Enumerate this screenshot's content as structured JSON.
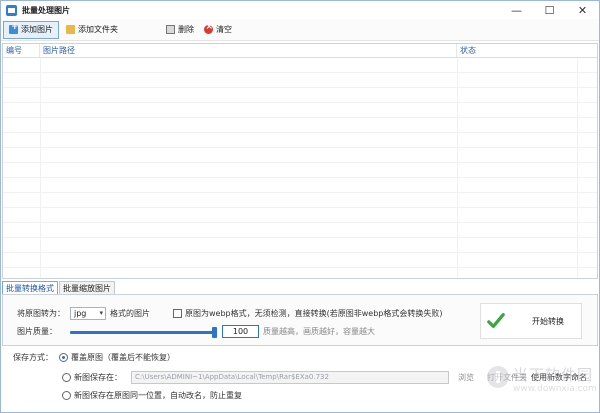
{
  "window": {
    "title": "批量处理图片",
    "controls": [
      "—",
      "☐",
      "✕"
    ]
  },
  "toolbar": {
    "add_image": "添加图片",
    "add_folder": "添加文件夹",
    "delete": "删除",
    "clear": "清空"
  },
  "list": {
    "columns": [
      "编号",
      "图片路径",
      "状态"
    ]
  },
  "tabs": [
    "批量转换格式",
    "批量缩放图片"
  ],
  "convert": {
    "convert_to_label": "将原图转为：",
    "format_value": "jpg",
    "format_suffix": "格式的图片",
    "webp_checkbox_label": "原图为webp格式，无须检测，直接转换(若原图非webp格式会转换失败)",
    "quality_label": "图片质量：",
    "quality_value": "100",
    "quality_fraction": 1.0,
    "quality_hint": "质量越高，画质越好，容量越大",
    "start_button": "开始转换"
  },
  "save": {
    "label": "保存方式：",
    "option_overwrite": "覆盖原图（覆盖后不能恢复）",
    "option_new_location": "新图保存在：",
    "path_value": "C:\\Users\\ADMINI~1\\AppData\\Local\\Temp\\Rar$EXa0.732",
    "browse": "浏览",
    "open_folder": "打开文件夹",
    "use_new_name": "使用新数字命名",
    "option_same_location": "新图保存在原图同一位置，自动改名，防止重复",
    "selected": "overwrite"
  },
  "watermark": {
    "text": "当下软件园",
    "sub": "www.downxia.com"
  },
  "colors": {
    "accent": "#2d72cf",
    "check": "#3aa63f",
    "header_text": "#2b5ca8"
  }
}
